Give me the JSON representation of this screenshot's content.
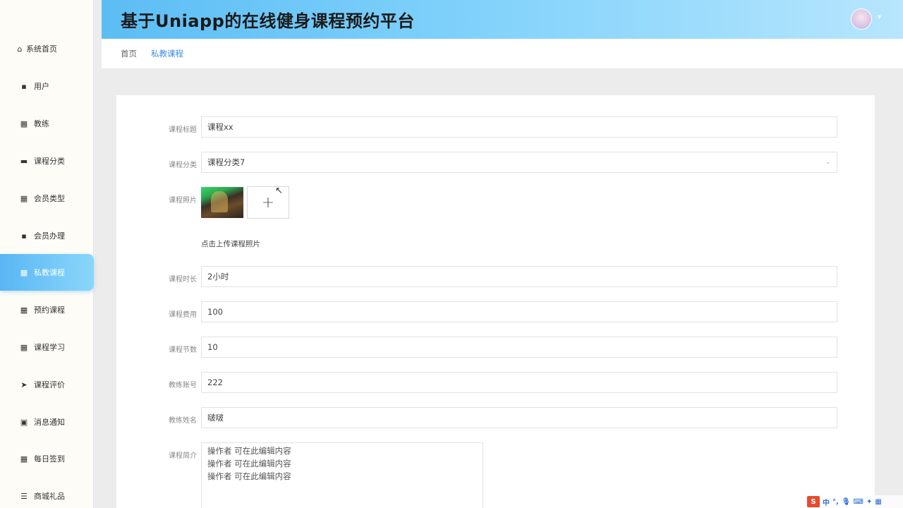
{
  "app_title": "基于Uniapp的在线健身课程预约平台",
  "sidebar": {
    "items": [
      {
        "label": "系统首页",
        "icon": "home-icon",
        "glyph": "⌂"
      },
      {
        "label": "用户",
        "icon": "user-icon",
        "glyph": "▪"
      },
      {
        "label": "教练",
        "icon": "grid-icon",
        "glyph": "▦"
      },
      {
        "label": "课程分类",
        "icon": "ticket-icon",
        "glyph": "▬"
      },
      {
        "label": "会员类型",
        "icon": "grid-icon",
        "glyph": "▦"
      },
      {
        "label": "会员办理",
        "icon": "card-icon",
        "glyph": "▪"
      },
      {
        "label": "私教课程",
        "icon": "grid-icon",
        "glyph": "▦",
        "active": true
      },
      {
        "label": "预约课程",
        "icon": "grid-icon",
        "glyph": "▦"
      },
      {
        "label": "课程学习",
        "icon": "grid-icon",
        "glyph": "▦"
      },
      {
        "label": "课程评价",
        "icon": "send-icon",
        "glyph": "➤"
      },
      {
        "label": "消息通知",
        "icon": "clipboard-icon",
        "glyph": "▣"
      },
      {
        "label": "每日签到",
        "icon": "grid-icon",
        "glyph": "▦"
      },
      {
        "label": "商城礼品",
        "icon": "list-icon",
        "glyph": "☰"
      }
    ]
  },
  "breadcrumb": {
    "home": "首页",
    "current": "私教课程"
  },
  "form": {
    "title_label": "课程标题",
    "title_value": "课程xx",
    "category_label": "课程分类",
    "category_value": "课程分类7",
    "photo_label": "课程照片",
    "upload_plus": "+",
    "upload_hint": "点击上传课程照片",
    "duration_label": "课程时长",
    "duration_value": "2小时",
    "fee_label": "课程费用",
    "fee_value": "100",
    "sessions_label": "课程节数",
    "sessions_value": "10",
    "coach_account_label": "教练账号",
    "coach_account_value": "222",
    "coach_name_label": "教练姓名",
    "coach_name_value": "啵啵",
    "intro_label": "课程简介",
    "intro_lines": [
      "操作者     可在此编辑内容",
      "操作者     可在此编辑内容",
      "操作者     可在此编辑内容"
    ]
  },
  "ime": {
    "logo": "S",
    "lang": "中"
  }
}
